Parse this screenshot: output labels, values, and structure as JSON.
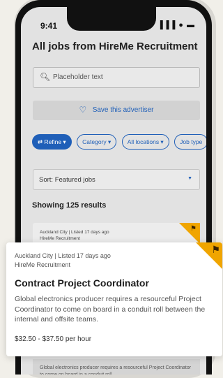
{
  "status_bar": {
    "time": "9:41",
    "icons": "▐▐▐ ● ▬"
  },
  "page": {
    "title": "All jobs from HireMe Recruitment"
  },
  "search": {
    "placeholder": "Placeholder text",
    "icon": "search-icon"
  },
  "save_advertiser": {
    "label": "Save this advertiser",
    "icon": "heart-plus-icon"
  },
  "filters": [
    {
      "label": "⇄ Refine ▾"
    },
    {
      "label": "Category ▾"
    },
    {
      "label": "All locations ▾"
    },
    {
      "label": "Job type"
    }
  ],
  "sort": {
    "label": "Sort: Featured jobs",
    "caret": "▼"
  },
  "results": {
    "count_text": "Showing 125 results"
  },
  "background_card": {
    "meta": "Auckland City | Listed 17 days ago",
    "advertiser": "HireMe Recruitment",
    "badge_icon": "⚑"
  },
  "featured_card": {
    "meta": "Auckland City | Listed 17 days ago",
    "advertiser": "HireMe Recruitment",
    "title": "Contract Project Coordinator",
    "description": "Global electronics producer requires a resourceful Project Coordinator to come on board in a conduit roll between the internal and offsite teams.",
    "pay": "$32.50 - $37.50 per hour",
    "badge_icon": "⚑"
  },
  "bottom_card": {
    "description": "Global electronics producer requires a resourceful Project Coordinator to come on board in a conduit roll"
  },
  "colors": {
    "accent": "#1f5fb8",
    "featured_badge": "#f0a500"
  }
}
